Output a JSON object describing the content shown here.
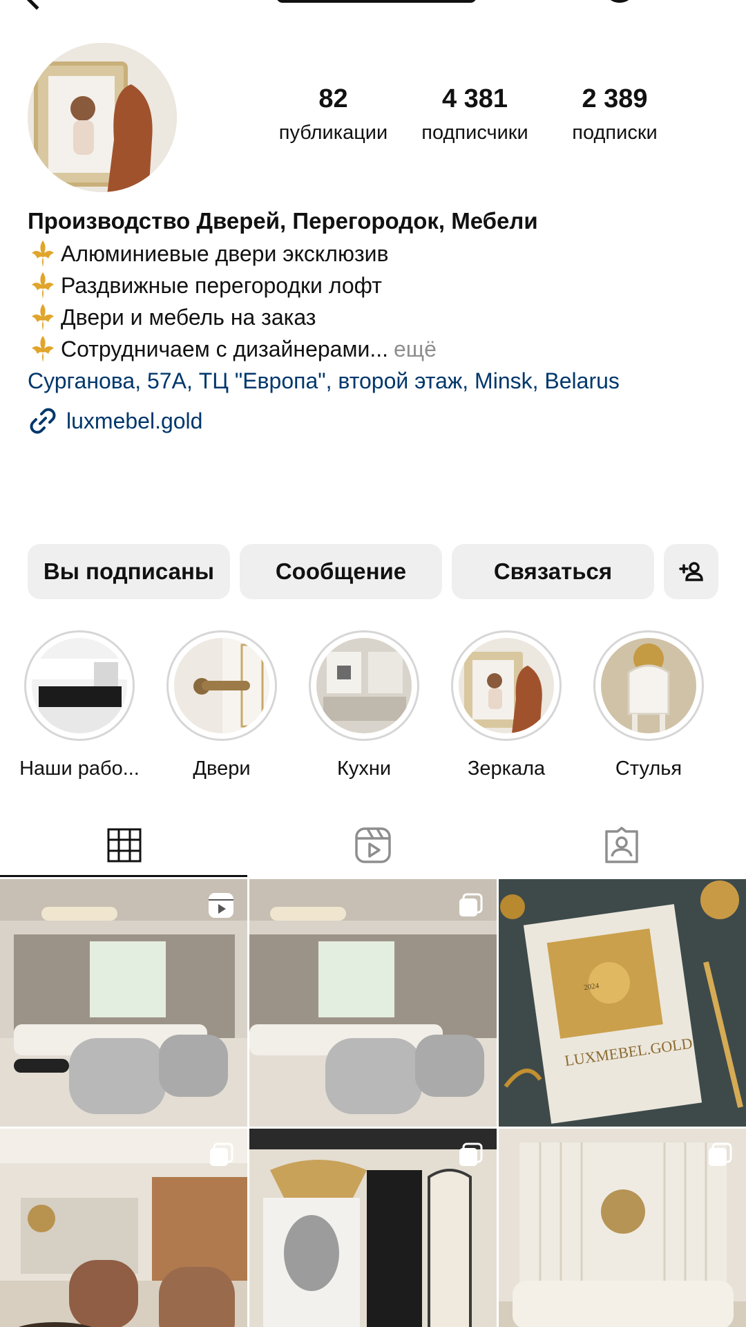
{
  "profile": {
    "stats": [
      {
        "value": "82",
        "label": "публикации"
      },
      {
        "value": "4 381",
        "label": "подписчики"
      },
      {
        "value": "2 389",
        "label": "подписки"
      }
    ],
    "name": "Производство Дверей, Перегородок, Мебели",
    "bio_lines": [
      "Алюминиевые  двери эксклюзив",
      "Раздвижные перегородки лофт",
      "Двери и мебель на заказ",
      "Сотрудничаем с дизайнерами..."
    ],
    "more_label": "ещё",
    "address": "Сурганова, 57А, ТЦ \"Европа\", второй этаж, Minsk, Belarus",
    "website": "luxmebel.gold"
  },
  "actions": {
    "following": "Вы подписаны",
    "message": "Сообщение",
    "contact": "Связаться"
  },
  "highlights": [
    {
      "label": "Наши рабо..."
    },
    {
      "label": "Двери"
    },
    {
      "label": "Кухни"
    },
    {
      "label": "Зеркала"
    },
    {
      "label": "Стулья"
    }
  ],
  "tabs": [
    {
      "icon": "grid-icon"
    },
    {
      "icon": "reels-icon"
    },
    {
      "icon": "tagged-icon"
    }
  ],
  "posts": [
    {
      "badge": "reels-badge-icon"
    },
    {
      "badge": "carousel-badge-icon"
    },
    {
      "badge": "",
      "overlay_title": "LUXMEBEL.GOLD",
      "overlay_year": "2024"
    },
    {
      "badge": "carousel-badge-icon"
    },
    {
      "badge": "carousel-badge-icon"
    },
    {
      "badge": "carousel-badge-icon"
    }
  ]
}
